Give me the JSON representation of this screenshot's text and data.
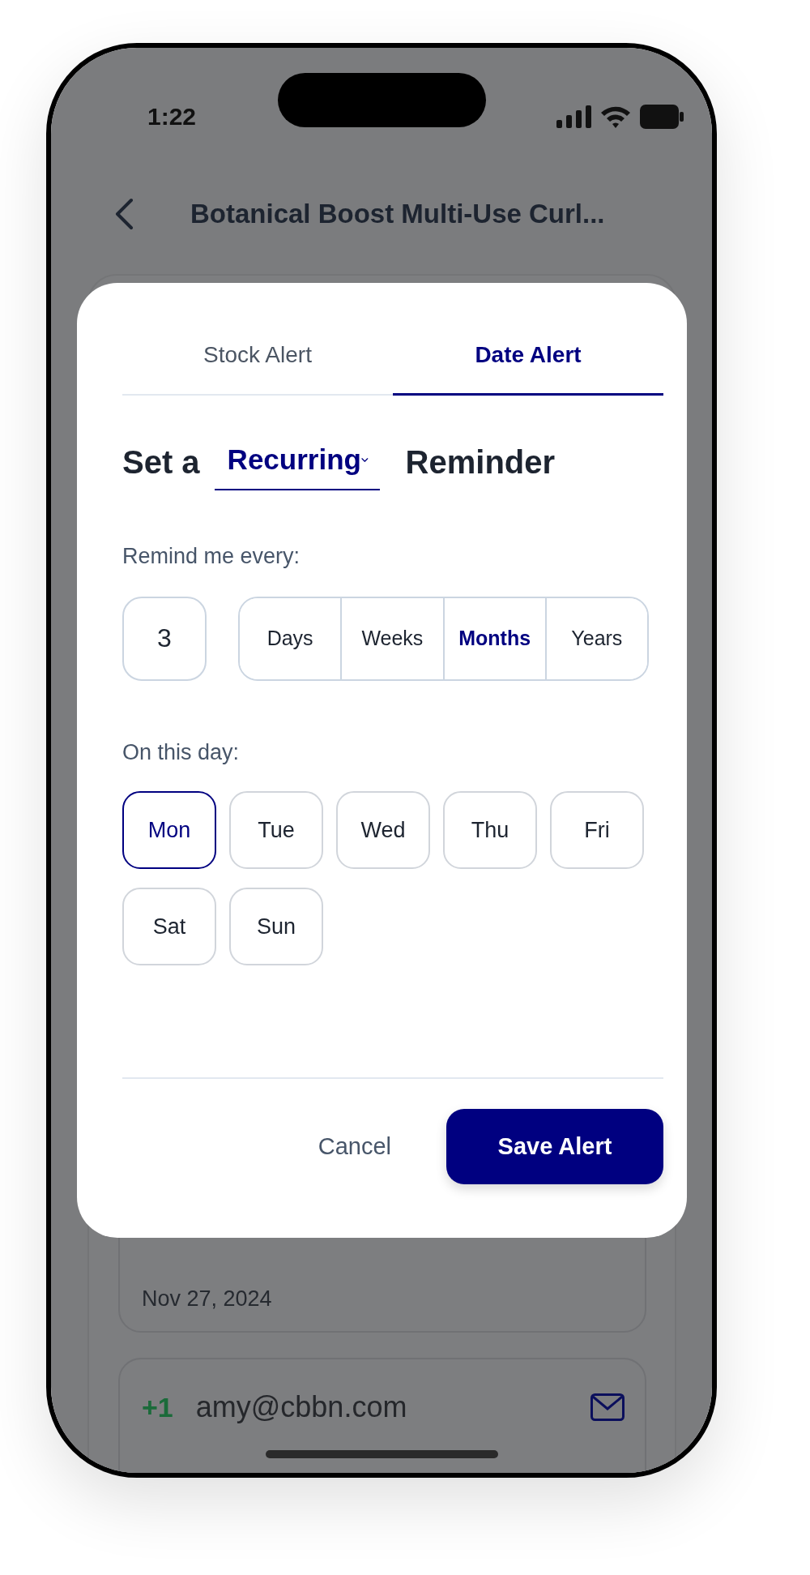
{
  "status_bar": {
    "time": "1:22"
  },
  "header": {
    "title": "Botanical Boost Multi-Use Curl..."
  },
  "background_cards": [
    {
      "date": "Nov 27, 2024"
    },
    {
      "count": "+1",
      "email": "amy@cbbn.com"
    }
  ],
  "modal": {
    "tabs": [
      {
        "label": "Stock Alert",
        "selected": false
      },
      {
        "label": "Date Alert",
        "selected": true
      }
    ],
    "heading": {
      "prefix": "Set a",
      "dropdown": "Recurring",
      "suffix": "Reminder"
    },
    "interval_label": "Remind me every:",
    "interval_value": "3",
    "units": [
      {
        "label": "Days",
        "selected": false
      },
      {
        "label": "Weeks",
        "selected": false
      },
      {
        "label": "Months",
        "selected": true
      },
      {
        "label": "Years",
        "selected": false
      }
    ],
    "day_label": "On this day:",
    "days": [
      {
        "label": "Mon",
        "selected": true
      },
      {
        "label": "Tue",
        "selected": false
      },
      {
        "label": "Wed",
        "selected": false
      },
      {
        "label": "Thu",
        "selected": false
      },
      {
        "label": "Fri",
        "selected": false
      },
      {
        "label": "Sat",
        "selected": false
      },
      {
        "label": "Sun",
        "selected": false
      }
    ],
    "cancel": "Cancel",
    "save": "Save Alert"
  }
}
